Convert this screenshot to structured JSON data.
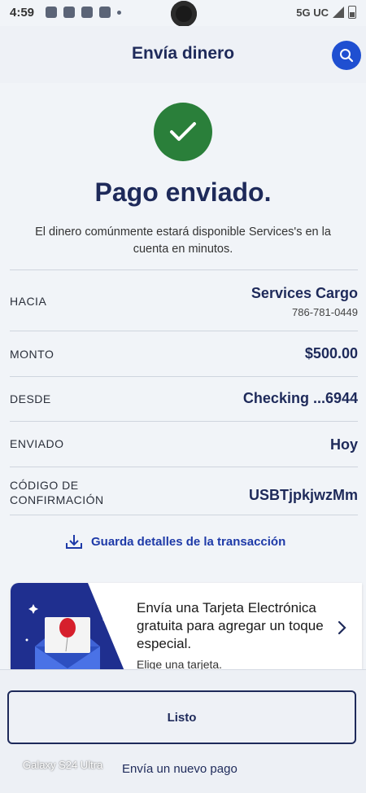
{
  "status_bar": {
    "time": "4:59",
    "network": "5G UC"
  },
  "header": {
    "title": "Envía dinero",
    "search_icon": "search-icon"
  },
  "confirmation": {
    "icon": "checkmark-icon",
    "headline": "Pago enviado.",
    "message": "El dinero comúnmente estará disponible Services's en la cuenta en minutos."
  },
  "details": {
    "to_label": "HACIA",
    "to_name": "Services Cargo",
    "to_phone": "786-781-0449",
    "amount_label": "MONTO",
    "amount_value": "$500.00",
    "from_label": "DESDE",
    "from_value": "Checking ...6944",
    "sent_label": "ENVIADO",
    "sent_value": "Hoy",
    "code_label_1": "CÓDIGO DE",
    "code_label_2": "CONFIRMACIÓN",
    "code_value": "USBTjpkjwzMm"
  },
  "save_details": {
    "icon": "download-icon",
    "label": "Guarda detalles de la transacción"
  },
  "promo": {
    "text": "Envía una Tarjeta Electrónica gratuita para agregar un toque especial.",
    "cta": "Elige una tarjeta.",
    "chevron_icon": "chevron-right-icon"
  },
  "footer": {
    "done_label": "Listo",
    "new_payment_label": "Envía un nuevo pago",
    "device_label": "Galaxy S24 Ultra"
  },
  "colors": {
    "brand_navy": "#1e2a5a",
    "accent_blue": "#1f4fd1",
    "success_green": "#2a7f3a"
  }
}
